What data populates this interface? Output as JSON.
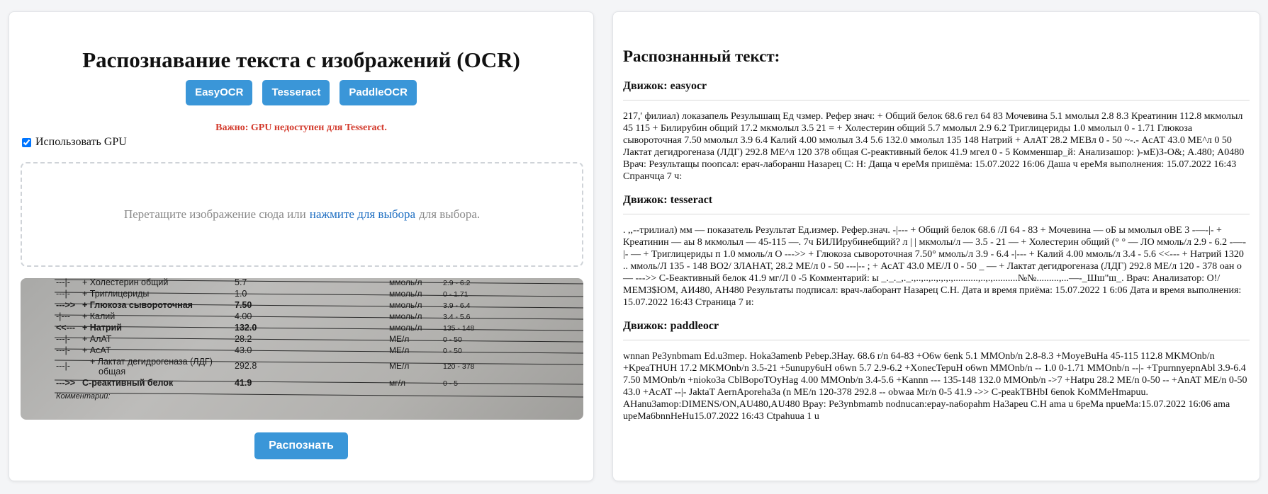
{
  "left": {
    "title": "Распознавание текста с изображений (OCR)",
    "engines": [
      "EasyOCR",
      "Tesseract",
      "PaddleOCR"
    ],
    "warning": "Важно: GPU недоступен для Tesseract.",
    "gpu_label": "Использовать GPU",
    "gpu_checked": true,
    "dropzone": {
      "before": "Перетащите изображение сюда или",
      "link": "нажмите для выбора",
      "after": "для выбора."
    },
    "preview_rows": [
      {
        "mark": "---|-",
        "name": "+ Холестерин общий",
        "value": "5.7",
        "unit": "ммоль/л",
        "ref": "2.9 - 6.2",
        "bold": false
      },
      {
        "mark": "---|-",
        "name": "+ Триглицериды",
        "value": "1.0",
        "unit": "ммоль/л",
        "ref": "0 - 1.71",
        "bold": false
      },
      {
        "mark": "--->>",
        "name": "+ Глюкоза сывороточная",
        "value": "7.50",
        "unit": "ммоль/л",
        "ref": "3.9 - 6.4",
        "bold": true
      },
      {
        "mark": "-|---",
        "name": "+ Калий",
        "value": "4.00",
        "unit": "ммоль/л",
        "ref": "3.4 - 5.6",
        "bold": false
      },
      {
        "mark": "<<---",
        "name": "+ Натрий",
        "value": "132.0",
        "unit": "ммоль/л",
        "ref": "135 - 148",
        "bold": true
      },
      {
        "mark": "---|-",
        "name": "+ АлАТ",
        "value": "28.2",
        "unit": "МЕ/л",
        "ref": "0 - 50",
        "bold": false
      },
      {
        "mark": "---|-",
        "name": "+ АсАТ",
        "value": "43.0",
        "unit": "МЕ/л",
        "ref": "0 - 50",
        "bold": false
      },
      {
        "mark": "---|-",
        "name": "+ Лактат дегидрогеназа (ЛДГ)",
        "name2": "общая",
        "value": "292.8",
        "unit": "МЕ/л",
        "ref": "120 - 378",
        "bold": false
      },
      {
        "mark": "--->>",
        "name": "С-реактивный белок",
        "value": "41.9",
        "unit": "мг/л",
        "ref": "0 - 5",
        "bold": true
      }
    ],
    "preview_comment": "Комментарий:",
    "recognize_label": "Распознать"
  },
  "results": {
    "title": "Распознанный текст:",
    "engines": [
      {
        "heading": "Движок: easyocr",
        "text": "217,' филиал) локазапель Резулышащ Ед чзмер. Рефер знач: + Общий белок 68.6 гел 64 83 Мочевина 5.1 ммолыл 2.8 8.3 Креатинин 112.8 мкмолыл 45 115 + Билирубин общий 17.2 мкмолыл 3.5 21 = + Холестерин общий 5.7 ммолыл 2.9 6.2 Триглицериды 1.0 ммолыл 0 - 1.71 Глюкоза сывороточная 7.50 ммолыл 3.9 6.4 Калий 4.00 ммолыл 3.4 5.6 132.0 ммолыл 135 148 Натрий + АлАТ 28.2 МЕВл 0 - 50 ~-.- АсАТ 43.0 МЕ^л 0 50 Лактат дегидрогеназа (ЛДГ) 292.8 МЕ^л 120 378 общая С-реактивный белок 41.9 мгел 0 - 5 Комменшар_й: Анализашор: )-мЕ)З-О&; А.480; А0480 Врач: Результащы поопсал: ерач-лаборанш Назарец С: Н: Даща ч ереМя пришёма: 15.07.2022 16:06 Даша ч ереМя выполнения: 15.07.2022 16:43 Спранчца 7 ч:"
      },
      {
        "heading": "Движок: tesseract",
        "text": ". ,,--трилиал) мм — показатель Результат Ед.измер. Рефер.знач. -|--- + Общий белок 68.6 /Л 64 - 83 + Мочевина — оБ ы ммолыл оВЕ 3 -—-|- + Креатинин — аы 8 мкмолыл — 45-115 —. 7ч БИЛИрубинебщий? л | | мкмолы/л — 3.5 - 21 — + Холестерин общий (° ° — ЛО ммоль/л 2.9 - 6.2 -—-|- — + Триглицериды п 1.0 ммоль/л О --->> + Глюкоза сывороточная 7.50° ммоль/л 3.9 - 6.4 -|--- + Калий 4.00 ммоль/л 3.4 - 5.6 <<--- + Натрий 1320 .. ммоль/Л 135 - 148 ВО2/ ЗЛАНАТ, 28.2 МЕ/л 0 - 50 ---|-- ; + АсАТ 43.0 МЕ/Л 0 - 50 _ — + Лактат дегидрогеназа (ЛДГ) 292.8 МЕ/л 120 - 378 оан о— --->> С-Беактивный белок 41.9 мг/Л 0 -5 Комментарий: ы _._._,._.,..,..,..,.,.,.,..........,..,.,..........№№.........,...—-_Шш\"ш_. Врач: Анализатор: О!/МЕМЗ$ЮМ, АИ480, АН480 Результаты подписал: врач-лаборант Назарец С.Н. Дата и время приёма: 15.07.2022 1 6:06 Дата и время выполнения: 15.07.2022 16:43 Страница 7 и:"
      },
      {
        "heading": "Движок: paddleocr",
        "text": "wnnan Pe3ynbmam Ed.u3mep. Hoka3amenb Pebep.3Hay. 68.6 r/n 64-83 +O6w 6enk 5.1 MMOnb/n 2.8-8.3 +MoyeBuHa 45-115 112.8 MKMOnb/n +KpeaTHUH 17.2 MKMOnb/n 3.5-21 +5unupy6uH o6wn 5.7 2.9-6.2 +XonecTepuH o6wn MMOnb/n -- 1.0 0-1.71 MMOnb/n --|- +TpurnnyepnAbl 3.9-6.4 7.50 MMOnb/n +nioko3a CblBopoTOyHag 4.00 MMOnb/n 3.4-5.6 +Kannn --- 135-148 132.0 MMOnb/n ->7 +Hatpu 28.2 ME/n 0-50 -- +AnAT ME/n 0-50 43.0 +AcAT --|- JaktaT AernAporeha3a (n ME/n 120-378 292.8 -- obwaa Mr/n 0-5 41.9 ->> C-peakTBHbI 6enok KoMMeHmapuu. AHanu3amop:DIMENS/ON,AU480,AU480 Bpay: Pe3ynbmamb nodnucan:epay-na6opahm Ha3apeu C.H ama u 6peMa npueMa:15.07.2022 16:06 ama upeMa6bnnHeHu15.07.2022 16:43 Ctpahuua 1 u"
      }
    ]
  }
}
